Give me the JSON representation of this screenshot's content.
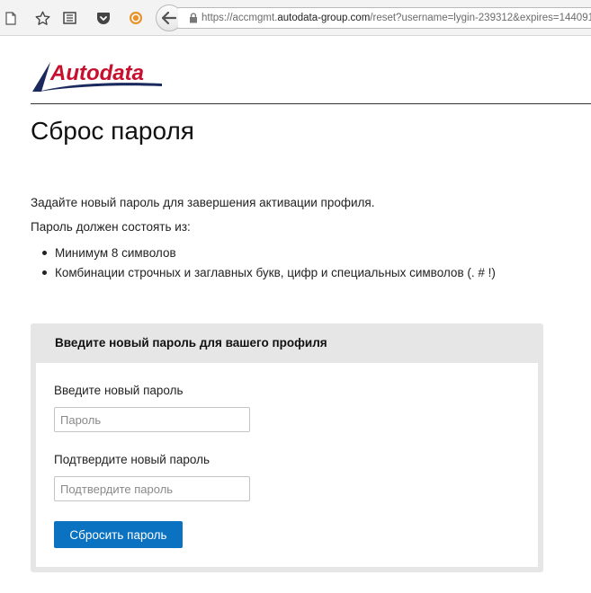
{
  "browser": {
    "url_prefix": "https://accmgmt.",
    "url_host": "autodata-group.com",
    "url_path": "/reset?username=lygin-239312&expires=144091"
  },
  "brand": {
    "logo_text": "Autodata",
    "logo_color": "#c8102e",
    "swoosh_color": "#1b2a5e"
  },
  "page": {
    "title": "Сброс пароля",
    "intro": "Задайте новый пароль для завершения активации профиля.",
    "requirements_title": "Пароль должен состоять из:",
    "requirements": [
      "Минимум 8 символов",
      "Комбинации строчных и заглавных букв, цифр и специальных символов (. # !)"
    ]
  },
  "form": {
    "heading": "Введите новый пароль для вашего профиля",
    "new_password_label": "Введите новый пароль",
    "new_password_placeholder": "Пароль",
    "confirm_label": "Подтвердите новый пароль",
    "confirm_placeholder": "Подтвердите пароль",
    "submit_label": "Сбросить пароль",
    "submit_color": "#0b72c2"
  }
}
